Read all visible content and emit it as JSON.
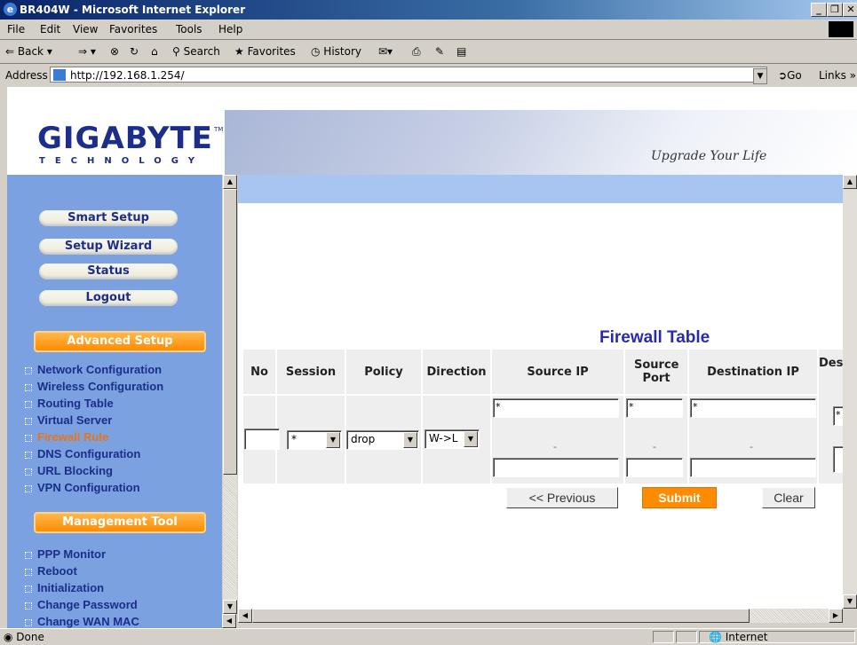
{
  "window": {
    "title": "BR404W - Microsoft Internet Explorer"
  },
  "menu": [
    "File",
    "Edit",
    "View",
    "Favorites",
    "Tools",
    "Help"
  ],
  "toolbar": {
    "back": "Back",
    "search": "Search",
    "favorites": "Favorites",
    "history": "History"
  },
  "address": {
    "label": "Address",
    "url": "http://192.168.1.254/",
    "go": "Go",
    "links": "Links"
  },
  "header": {
    "logo": "GIGABYTE",
    "logo_sub": "TECHNOLOGY",
    "tagline": "Upgrade Your Life"
  },
  "sidebar": {
    "buttons": [
      "Smart Setup",
      "Setup Wizard",
      "Status",
      "Logout"
    ],
    "advanced_title": "Advanced Setup",
    "advanced_items": [
      "Network Configuration",
      "Wireless Configuration",
      "Routing Table",
      "Virtual Server",
      "Firewall Rule",
      "DNS Configuration",
      "URL Blocking",
      "VPN Configuration"
    ],
    "active_item": "Firewall Rule",
    "management_title": "Management Tool",
    "management_items": [
      "PPP Monitor",
      "Reboot",
      "Initialization",
      "Change Password",
      "Change WAN MAC"
    ]
  },
  "firewall": {
    "title": "Firewall Table",
    "columns": [
      "No",
      "Session",
      "Policy",
      "Direction",
      "Source IP",
      "Source Port",
      "Destination IP",
      "Des"
    ],
    "row": {
      "no": "",
      "session": "*",
      "policy": "drop",
      "direction": "W->L",
      "source_ip_from": "*",
      "source_ip_to": "",
      "source_ip_sep": "-",
      "source_port_from": "*",
      "source_port_to": "",
      "source_port_sep": "-",
      "dest_ip_from": "*",
      "dest_ip_to": "",
      "dest_ip_sep": "-",
      "dest_port_from": "*"
    },
    "buttons": {
      "previous": "<< Previous",
      "submit": "Submit",
      "clear": "Clear"
    }
  },
  "status": {
    "left": "Done",
    "zone": "Internet"
  }
}
